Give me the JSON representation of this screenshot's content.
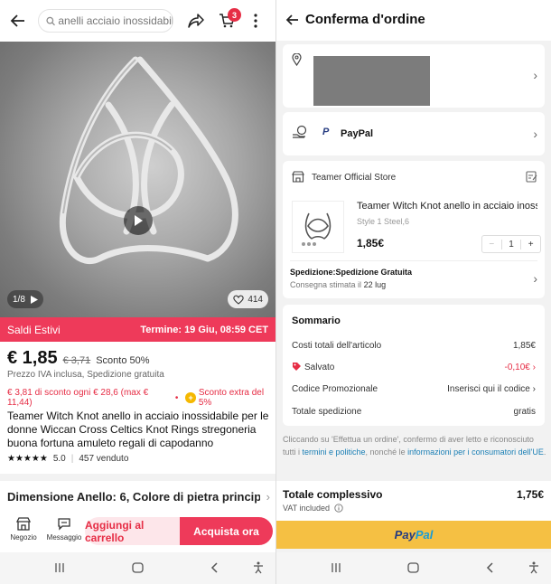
{
  "product_page": {
    "search_placeholder": "anelli acciaio inossidabile",
    "cart_count": "3",
    "image_counter": "1/8",
    "likes": "414",
    "sale_label": "Saldi Estivi",
    "sale_deadline": "Termine: 19 Giu, 08:59 CET",
    "price": "€ 1,85",
    "old_price": "€ 3,71",
    "discount": "Sconto 50%",
    "vat_note": "Prezzo IVA inclusa, Spedizione gratuita",
    "promo_coupon": "€ 3,81 di sconto ogni € 28,6 (max € 11,44)",
    "promo_extra": "Sconto extra del 5%",
    "title": "Teamer Witch Knot anello in acciaio inossidabile per le donne Wiccan Cross Celtics Knot Rings stregoneria buona fortuna amuleto regali di capodanno",
    "rating_stars": "★★★★★",
    "rating": "5.0",
    "sold": "457 venduto",
    "variant": "Dimensione Anello: 6, Colore di pietra princip...",
    "bottom_bar": {
      "store_label": "Negozio",
      "messages_label": "Messaggio",
      "add_to_cart": "Aggiungi al carrello",
      "buy_now": "Acquista ora"
    }
  },
  "checkout_page": {
    "title": "Conferma d'ordine",
    "payment_method": "PayPal",
    "store_name": "Teamer Official Store",
    "item": {
      "name": "Teamer Witch Knot anello in acciaio inossi...",
      "variant": "Style 1 Steel,6",
      "price": "1,85€",
      "quantity": "1"
    },
    "shipping": {
      "label": "Spedizione:Spedizione Gratuita",
      "delivery": "Consegna stimata il",
      "delivery_date": "22 lug"
    },
    "summary": {
      "title": "Sommario",
      "rows": [
        {
          "label": "Costi totali dell'articolo",
          "value": "1,85€"
        },
        {
          "label": "Salvato",
          "value": "-0,10€"
        },
        {
          "label": "Codice Promozionale",
          "value": "Inserisci qui il codice"
        },
        {
          "label": "Totale spedizione",
          "value": "gratis"
        }
      ]
    },
    "legal": {
      "part1": "Cliccando su 'Effettua un ordine', confermo di aver letto e riconosciuto tutti i ",
      "link1": "termini e politiche",
      "part2": ", nonché le ",
      "link2": "informazioni per i consumatori dell'UE",
      "part3": "."
    },
    "total_label": "Totale complessivo",
    "total_value": "1,75€",
    "vat_included": "VAT included",
    "paypal_dark": "Pay",
    "paypal_light": "Pal"
  },
  "colors": {
    "accent_red": "#ee3a5a",
    "paypal_yellow": "#f5c043",
    "link_blue": "#1a7fb5"
  }
}
